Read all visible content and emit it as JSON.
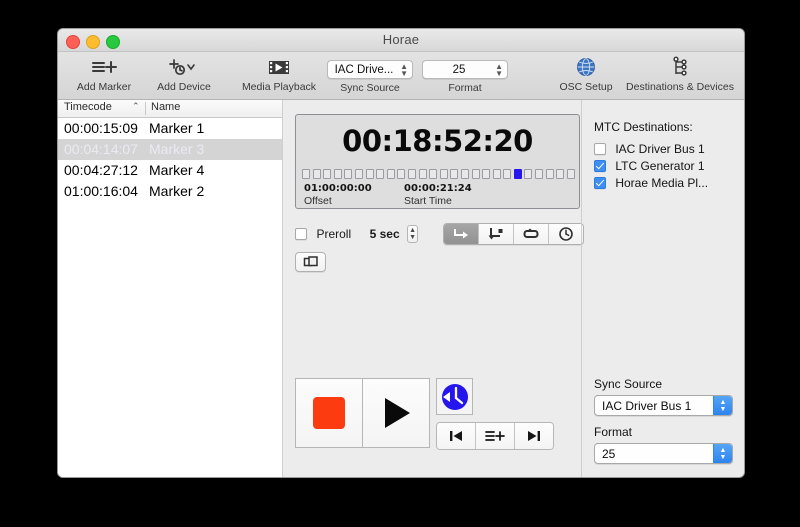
{
  "window": {
    "title": "Horae",
    "traffic_lights": [
      "close",
      "minimize",
      "zoom"
    ]
  },
  "toolbar": {
    "items": [
      {
        "label": "Add Marker",
        "icon": "list-plus-icon"
      },
      {
        "label": "Add Device",
        "icon": "add-device-clock-icon"
      },
      {
        "label": "Media Playback",
        "icon": "film-play-icon"
      },
      {
        "label": "OSC Setup",
        "icon": "globe-icon"
      },
      {
        "label": "Destinations & Devices",
        "icon": "devices-tree-icon"
      }
    ],
    "sync_source": {
      "label": "Sync Source",
      "value": "IAC Drive..."
    },
    "format": {
      "label": "Format",
      "value": "25"
    }
  },
  "marker_list": {
    "columns": [
      "Timecode",
      "Name"
    ],
    "sort_indicator": "⌃",
    "rows": [
      {
        "timecode": "00:00:15:09",
        "name": "Marker 1",
        "selected": false
      },
      {
        "timecode": "00:04:14:07",
        "name": "Marker 3",
        "selected": true
      },
      {
        "timecode": "00:04:27:12",
        "name": "Marker 4",
        "selected": false
      },
      {
        "timecode": "01:00:16:04",
        "name": "Marker 2",
        "selected": false
      }
    ]
  },
  "timecode_display": {
    "current": "00:18:52:20",
    "offset_value": "01:00:00:00",
    "offset_label": "Offset",
    "start_value": "00:00:21:24",
    "start_label": "Start Time",
    "led_total": 26,
    "led_active_index": 20,
    "led_on_color": "#2516ee"
  },
  "preroll": {
    "checked": false,
    "label": "Preroll",
    "seconds": "5 sec"
  },
  "mode_segments": [
    {
      "icon": "arrow-right-hook-icon",
      "active": true
    },
    {
      "icon": "arrow-down-hook-square-icon",
      "active": false
    },
    {
      "icon": "loop-repeat-icon",
      "active": false
    },
    {
      "icon": "clock-outline-icon",
      "active": false
    }
  ],
  "duplicate_button": {
    "icon": "duplicate-icon"
  },
  "transport": {
    "stop": {
      "icon": "stop-square-icon",
      "color": "#fd3b11"
    },
    "play": {
      "icon": "play-triangle-icon"
    },
    "clock": {
      "icon": "blue-clock-icon",
      "color": "#2516ee"
    },
    "nav": [
      {
        "icon": "skip-previous-icon"
      },
      {
        "icon": "list-plus-icon"
      },
      {
        "icon": "skip-next-icon"
      }
    ]
  },
  "mtc": {
    "title": "MTC Destinations:",
    "destinations": [
      {
        "label": "IAC Driver Bus 1",
        "checked": false
      },
      {
        "label": "LTC Generator 1",
        "checked": true
      },
      {
        "label": "Horae Media Pl...",
        "checked": true
      }
    ]
  },
  "sidebar_sync_source": {
    "label": "Sync Source",
    "value": "IAC Driver Bus 1"
  },
  "sidebar_format": {
    "label": "Format",
    "value": "25"
  }
}
